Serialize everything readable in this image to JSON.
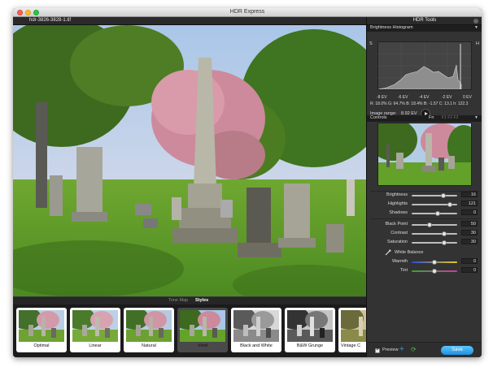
{
  "window": {
    "title": "HDR Express"
  },
  "document": {
    "filename": "hdr-3826-3828-1.tif"
  },
  "modes": {
    "tone_map": "Tone Map",
    "styles": "Styles"
  },
  "styles": [
    {
      "label": "Optimal",
      "selected": false
    },
    {
      "label": "Linear",
      "selected": false
    },
    {
      "label": "Natural",
      "selected": false
    },
    {
      "label": "Vivid",
      "selected": true
    },
    {
      "label": "Black and White",
      "selected": false
    },
    {
      "label": "B&W Grunge",
      "selected": false
    },
    {
      "label": "Vintage C",
      "selected": false
    }
  ],
  "panel": {
    "title": "HDR Tools",
    "histogram": {
      "title": "Brightness Histogram",
      "left_marker": "S",
      "right_marker": "H",
      "ev_labels": [
        "-8 EV",
        "-6 EV",
        "-4 EV",
        "-2 EV",
        "0 EV"
      ],
      "stats": "R: 18.0% G: 64.7% B: 18.4%   B: -1.57 C: 13.1   h: 122.3",
      "image_range_label": "Image range:",
      "image_range_value": "8.92 EV"
    },
    "controls": {
      "title": "Controls",
      "fn_label": "Fn",
      "fn_slots": "F1 F2 F3",
      "brightness": {
        "label": "Brightness",
        "value": "16"
      },
      "highlights": {
        "label": "Highlights",
        "value": "121"
      },
      "shadows": {
        "label": "Shadows",
        "value": "0"
      },
      "black_point": {
        "label": "Black Point",
        "value": "50"
      },
      "contrast": {
        "label": "Contrast",
        "value": "30"
      },
      "saturation": {
        "label": "Saturation",
        "value": "30"
      },
      "white_balance": {
        "label": "White Balance"
      },
      "warmth": {
        "label": "Warmth",
        "value": "0"
      },
      "tint": {
        "label": "Tint",
        "value": "0"
      }
    },
    "bottom": {
      "preview_label": "Preview",
      "preview_checked": true,
      "save_label": "Save"
    }
  },
  "colors": {
    "accent": "#1e90e0",
    "panel_bg": "#333333",
    "save_button": "#3aa8f0"
  }
}
